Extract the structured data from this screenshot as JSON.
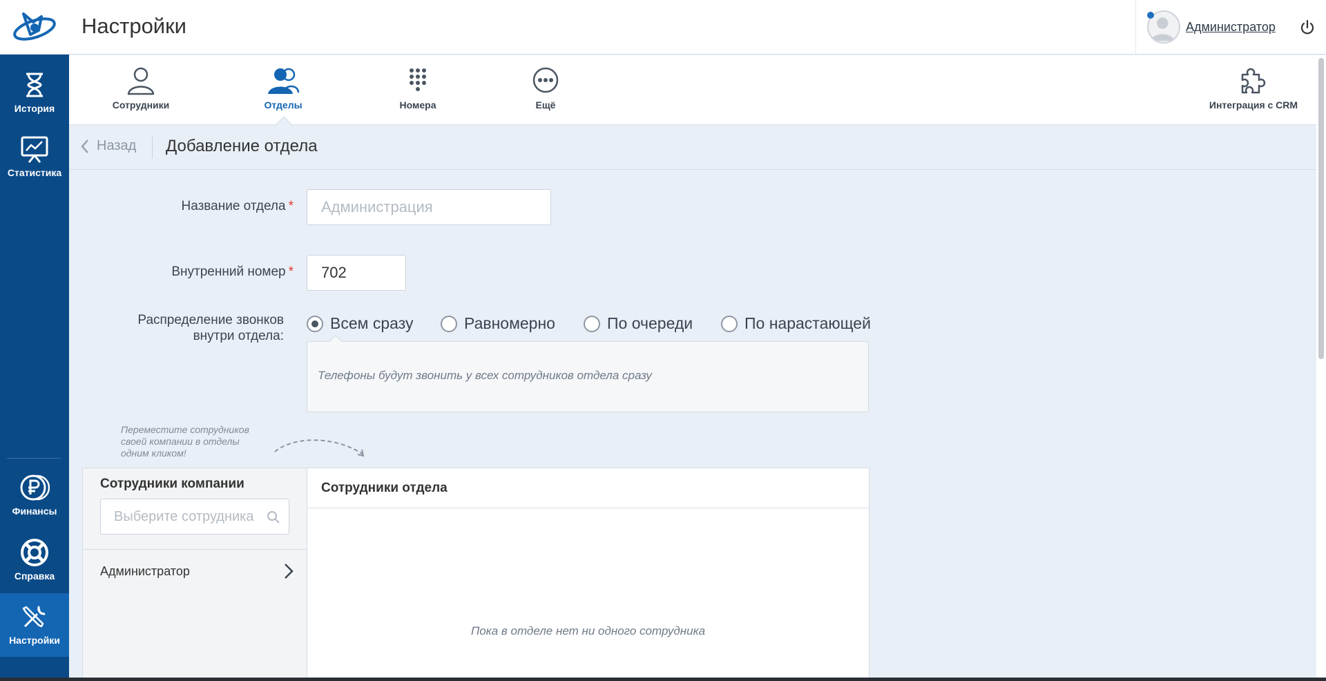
{
  "header": {
    "title": "Настройки",
    "user_name": "Администратор"
  },
  "sidebar": {
    "items": [
      {
        "label": "История",
        "icon": "hourglass-icon"
      },
      {
        "label": "Статистика",
        "icon": "presentation-chart-icon"
      },
      {
        "label": "Финансы",
        "icon": "ruble-coins-icon"
      },
      {
        "label": "Справка",
        "icon": "lifebuoy-icon"
      },
      {
        "label": "Настройки",
        "icon": "wrench-screwdriver-icon",
        "active": true
      }
    ]
  },
  "tabs": [
    {
      "label": "Сотрудники",
      "icon": "user-icon"
    },
    {
      "label": "Отделы",
      "icon": "users-icon",
      "active": true
    },
    {
      "label": "Номера",
      "icon": "keypad-icon"
    },
    {
      "label": "Ещё",
      "icon": "more-icon"
    },
    {
      "label": "Интеграция с CRM",
      "icon": "puzzle-icon"
    }
  ],
  "subheader": {
    "back_label": "Назад",
    "title": "Добавление отдела"
  },
  "form": {
    "name_label": "Название отдела",
    "name_placeholder": "Администрация",
    "ext_label": "Внутренний номер",
    "ext_value": "702",
    "required_mark": "*",
    "distribution_label_line1": "Распределение звонков",
    "distribution_label_line2": "внутри отдела:",
    "distribution_options": [
      {
        "label": "Всем сразу",
        "selected": true
      },
      {
        "label": "Равномерно",
        "selected": false
      },
      {
        "label": "По очереди",
        "selected": false
      },
      {
        "label": "По нарастающей",
        "selected": false
      }
    ],
    "distribution_hint": "Телефоны будут звонить у всех сотрудников отдела сразу"
  },
  "drag_hint": {
    "line1": "Переместите сотрудников",
    "line2": "своей компании в отделы",
    "line3": "одним кликом!"
  },
  "company_panel": {
    "title": "Сотрудники компании",
    "search_placeholder": "Выберите сотрудника",
    "employees": [
      "Администратор"
    ]
  },
  "dept_panel": {
    "title": "Сотрудники отдела",
    "empty_text": "Пока в отделе нет ни одного сотрудника"
  },
  "colors": {
    "sidebar": "#0a4a87",
    "sidebar_active": "#1466b3",
    "accent": "#1466b3",
    "page_bg": "#e9eff7",
    "required": "#e03a3a"
  }
}
